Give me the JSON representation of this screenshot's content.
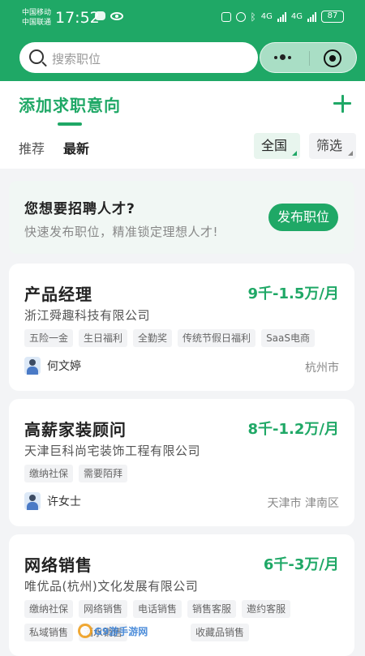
{
  "status_bar": {
    "carrier1": "中国移动",
    "carrier2": "中国联通",
    "time": "17:52",
    "net1": "4G",
    "net2": "4G",
    "battery": "87"
  },
  "search": {
    "placeholder": "搜索职位"
  },
  "header": {
    "title": "添加求职意向",
    "tabs": [
      "推荐",
      "最新"
    ],
    "region_chip": "全国",
    "filter_chip": "筛选"
  },
  "banner": {
    "title": "您想要招聘人才?",
    "subtitle": "快速发布职位，精准锁定理想人才!",
    "button": "发布职位"
  },
  "jobs": [
    {
      "title": "产品经理",
      "salary": "9千-1.5万/月",
      "company": "浙江舜趣科技有限公司",
      "tags": [
        "五险一金",
        "生日福利",
        "全勤奖",
        "传统节假日福利",
        "SaaS电商"
      ],
      "recruiter": "何文婷",
      "location": "杭州市"
    },
    {
      "title": "高薪家装顾问",
      "salary": "8千-1.2万/月",
      "company": "天津巨科尚宅装饰工程有限公司",
      "tags": [
        "缴纳社保",
        "需要陌拜"
      ],
      "recruiter": "许女士",
      "location": "天津市 津南区"
    },
    {
      "title": "网络销售",
      "salary": "6千-3万/月",
      "company": "唯优品(杭州)文化发展有限公司",
      "tags": [
        "缴纳社保",
        "网络销售",
        "电话销售",
        "销售客服",
        "邀约客服",
        "私域销售",
        "酒水销售",
        "",
        "收藏品销售"
      ]
    }
  ],
  "watermark": "G9游手游网",
  "colors": {
    "brand_green": "#1fa866",
    "banner_bg": "#f1f7f4"
  }
}
